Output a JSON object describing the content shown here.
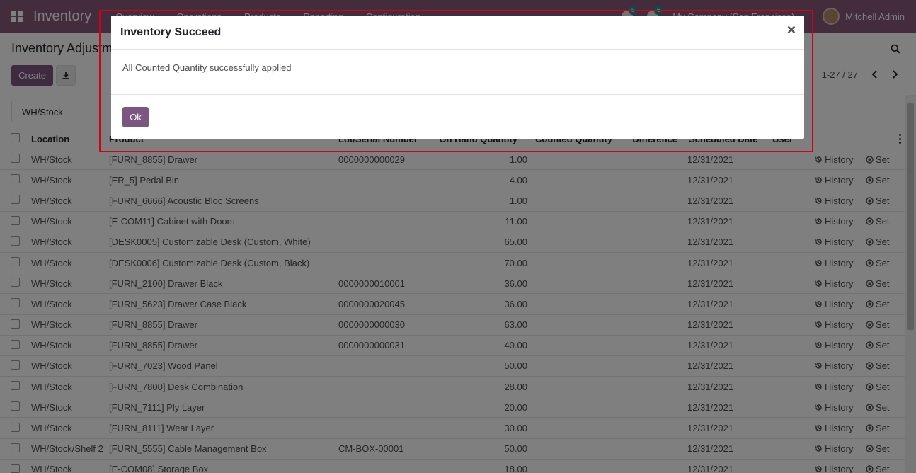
{
  "navbar": {
    "app_name": "Inventory",
    "menu": [
      "Overview",
      "Operations",
      "Products",
      "Reporting",
      "Configuration"
    ],
    "company": "My Company (San Francisco)",
    "user": "Mitchell Admin",
    "chat_badge": "5",
    "activity_badge": "6"
  },
  "control": {
    "breadcrumb": "Inventory Adjustments",
    "create_label": "Create",
    "pager": "1-27 / 27",
    "filter": "WH/Stock"
  },
  "table": {
    "headers": {
      "location": "Location",
      "product": "Product",
      "lot": "Lot/Serial Number",
      "on_hand": "On Hand Quantity",
      "counted": "Counted Quantity",
      "difference": "Difference",
      "date": "Scheduled Date",
      "user": "User"
    },
    "history_label": "History",
    "set_label": "Set",
    "rows": [
      {
        "location": "WH/Stock",
        "product": "[FURN_8855] Drawer",
        "lot": "0000000000029",
        "on_hand": "1.00",
        "date": "12/31/2021"
      },
      {
        "location": "WH/Stock",
        "product": "[ER_5] Pedal Bin",
        "lot": "",
        "on_hand": "4.00",
        "date": "12/31/2021"
      },
      {
        "location": "WH/Stock",
        "product": "[FURN_6666] Acoustic Bloc Screens",
        "lot": "",
        "on_hand": "1.00",
        "date": "12/31/2021"
      },
      {
        "location": "WH/Stock",
        "product": "[E-COM11] Cabinet with Doors",
        "lot": "",
        "on_hand": "11.00",
        "date": "12/31/2021"
      },
      {
        "location": "WH/Stock",
        "product": "[DESK0005] Customizable Desk (Custom, White)",
        "lot": "",
        "on_hand": "65.00",
        "date": "12/31/2021"
      },
      {
        "location": "WH/Stock",
        "product": "[DESK0006] Customizable Desk (Custom, Black)",
        "lot": "",
        "on_hand": "70.00",
        "date": "12/31/2021"
      },
      {
        "location": "WH/Stock",
        "product": "[FURN_2100] Drawer Black",
        "lot": "0000000010001",
        "on_hand": "36.00",
        "date": "12/31/2021"
      },
      {
        "location": "WH/Stock",
        "product": "[FURN_5623] Drawer Case Black",
        "lot": "0000000020045",
        "on_hand": "36.00",
        "date": "12/31/2021"
      },
      {
        "location": "WH/Stock",
        "product": "[FURN_8855] Drawer",
        "lot": "0000000000030",
        "on_hand": "63.00",
        "date": "12/31/2021"
      },
      {
        "location": "WH/Stock",
        "product": "[FURN_8855] Drawer",
        "lot": "0000000000031",
        "on_hand": "40.00",
        "date": "12/31/2021"
      },
      {
        "location": "WH/Stock",
        "product": "[FURN_7023] Wood Panel",
        "lot": "",
        "on_hand": "50.00",
        "date": "12/31/2021"
      },
      {
        "location": "WH/Stock",
        "product": "[FURN_7800] Desk Combination",
        "lot": "",
        "on_hand": "28.00",
        "date": "12/31/2021"
      },
      {
        "location": "WH/Stock",
        "product": "[FURN_7111] Ply Layer",
        "lot": "",
        "on_hand": "20.00",
        "date": "12/31/2021"
      },
      {
        "location": "WH/Stock",
        "product": "[FURN_8111] Wear Layer",
        "lot": "",
        "on_hand": "30.00",
        "date": "12/31/2021"
      },
      {
        "location": "WH/Stock/Shelf 2",
        "product": "[FURN_5555] Cable Management Box",
        "lot": "CM-BOX-00001",
        "on_hand": "50.00",
        "date": "12/31/2021"
      },
      {
        "location": "WH/Stock",
        "product": "[E-COM08] Storage Box",
        "lot": "",
        "on_hand": "18.00",
        "date": "12/31/2021"
      }
    ]
  },
  "modal": {
    "title": "Inventory Succeed",
    "close": "×",
    "message": "All Counted Quantity successfully applied",
    "ok_label": "Ok"
  },
  "colors": {
    "navbar": "#875a7b",
    "primary_button": "#7c5680",
    "highlight_border": "#d0021b"
  }
}
